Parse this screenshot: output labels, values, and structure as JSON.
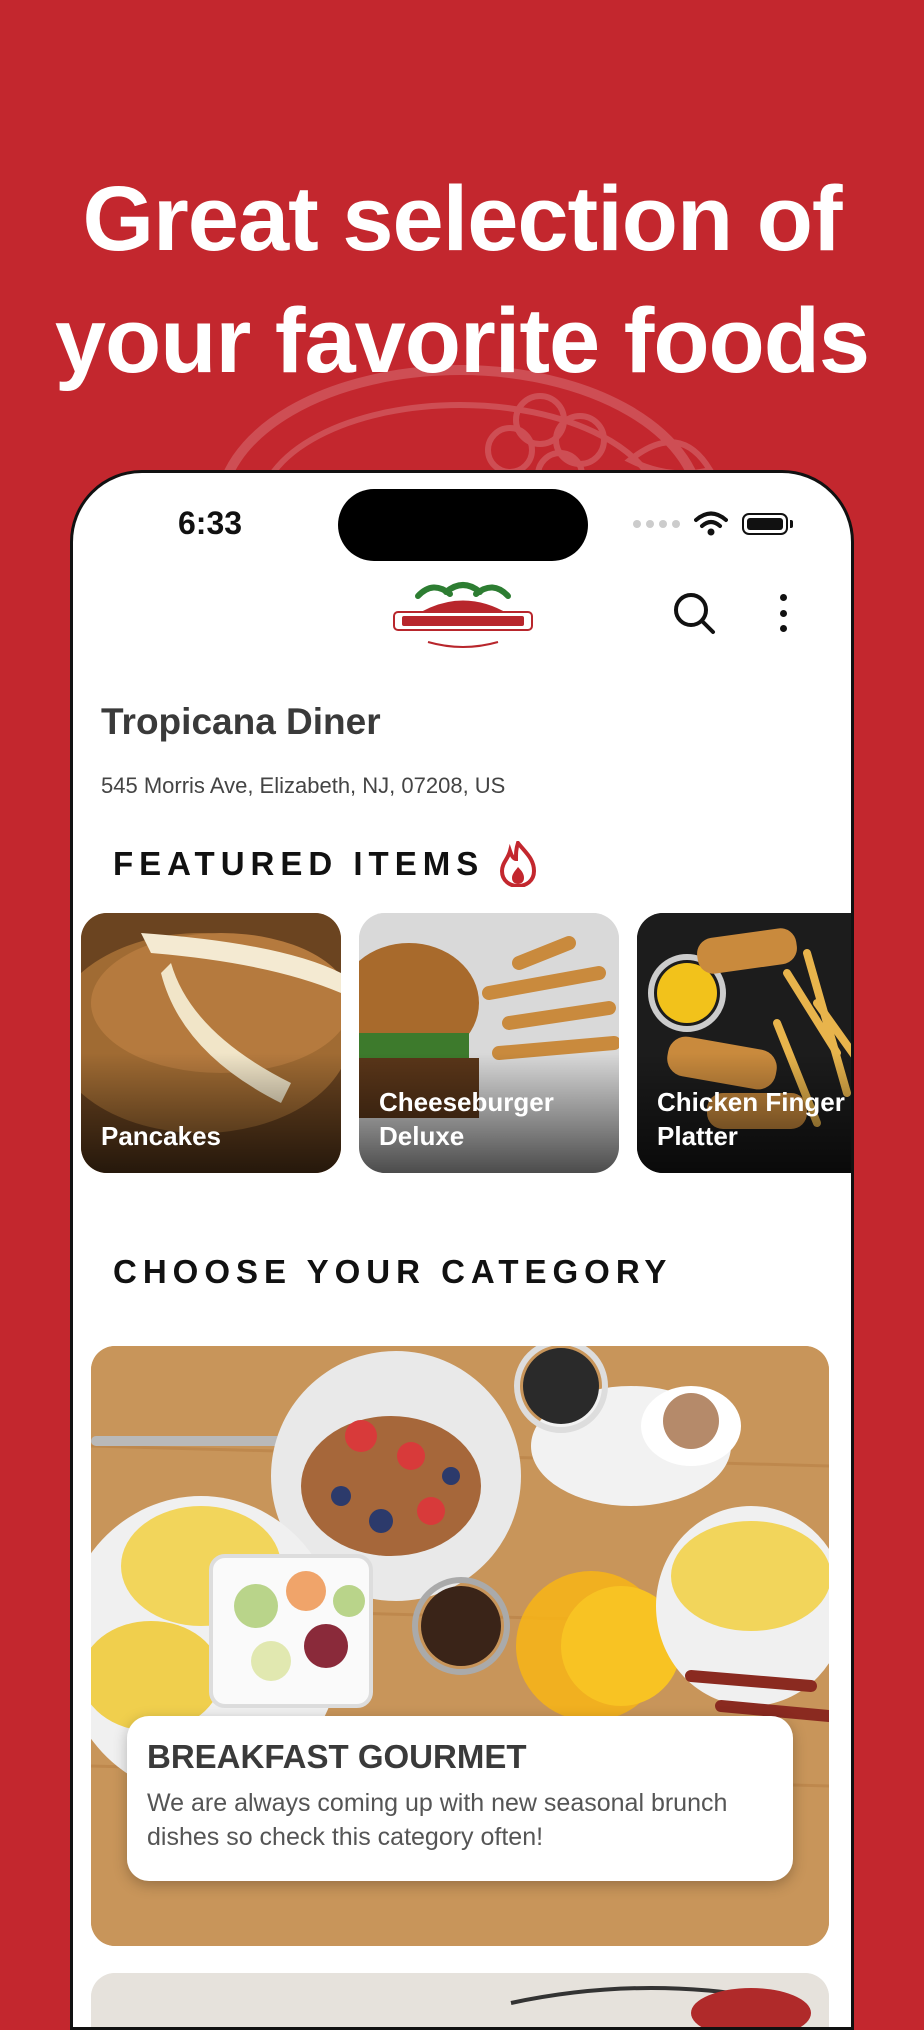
{
  "headline": {
    "line1": "Great selection of",
    "line2": "your favorite foods"
  },
  "status_bar": {
    "time": "6:33"
  },
  "header": {
    "logo_icon": "tropicana-logo",
    "search_icon": "search-icon",
    "more_icon": "more-vertical-icon"
  },
  "restaurant": {
    "name": "Tropicana Diner",
    "address": "545 Morris Ave, Elizabeth, NJ, 07208, US"
  },
  "featured": {
    "title": "FEATURED ITEMS",
    "icon": "flame-icon",
    "items": [
      {
        "label": "Pancakes"
      },
      {
        "label": "Cheeseburger Deluxe"
      },
      {
        "label": "Chicken Finger Platter"
      }
    ]
  },
  "categories": {
    "title": "CHOOSE YOUR CATEGORY",
    "items": [
      {
        "name": "BREAKFAST GOURMET",
        "description": "We are always coming up with new seasonal brunch dishes so check this category often!"
      }
    ]
  },
  "colors": {
    "brand_red": "#c3272e",
    "text_dark": "#3a3a3a"
  }
}
